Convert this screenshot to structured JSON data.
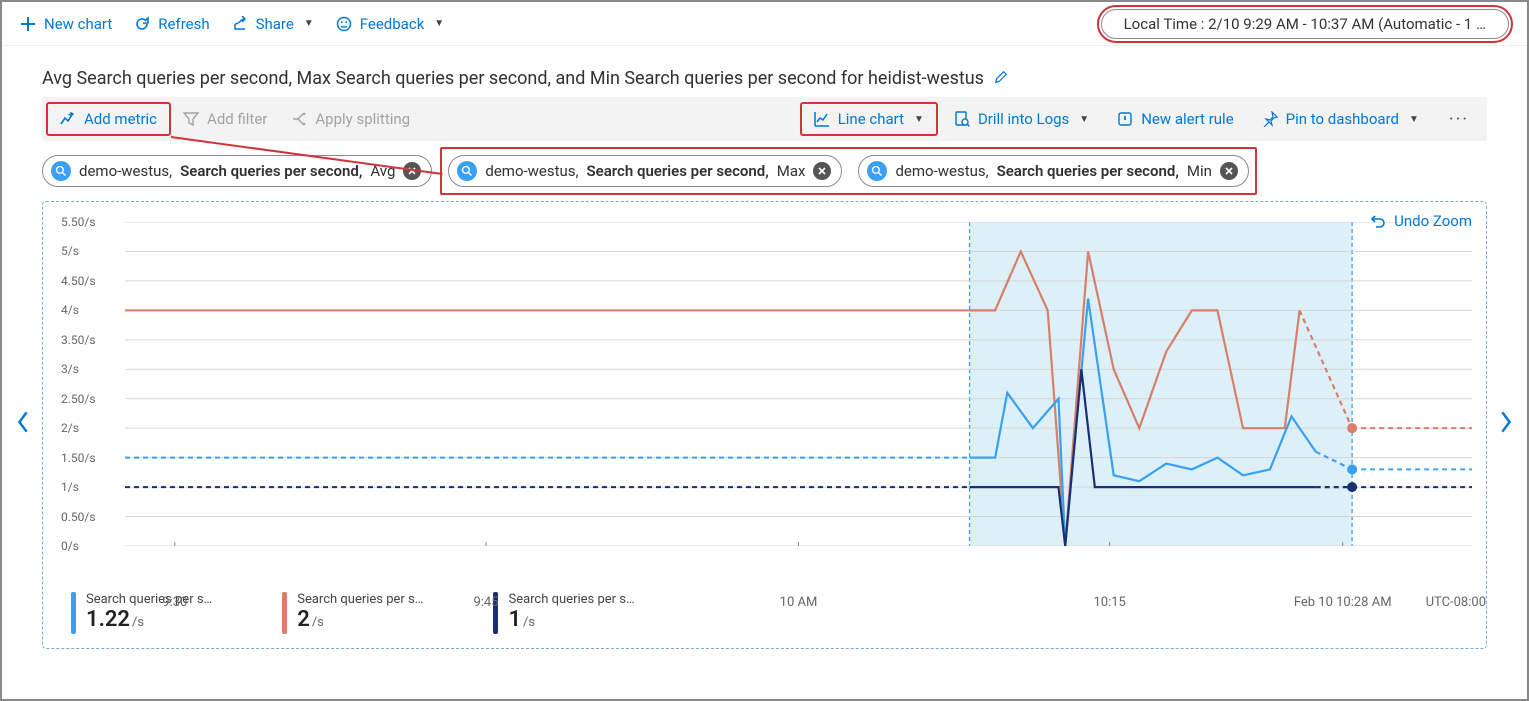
{
  "toolbar": {
    "new_chart": "New chart",
    "refresh": "Refresh",
    "share": "Share",
    "feedback": "Feedback"
  },
  "time_range": "Local Time : 2/10 9:29 AM - 10:37 AM (Automatic - 1 …",
  "title": "Avg Search queries per second, Max Search queries per second, and Min Search queries per second for heidist-westus",
  "secondary": {
    "add_metric": "Add metric",
    "add_filter": "Add filter",
    "apply_splitting": "Apply splitting",
    "chart_type": "Line chart",
    "drill_logs": "Drill into Logs",
    "new_alert": "New alert rule",
    "pin_dash": "Pin to dashboard"
  },
  "chips": [
    {
      "scope": "demo-westus,",
      "metric": "Search queries per second,",
      "agg": "Avg"
    },
    {
      "scope": "demo-westus,",
      "metric": "Search queries per second,",
      "agg": "Max"
    },
    {
      "scope": "demo-westus,",
      "metric": "Search queries per second,",
      "agg": "Min"
    }
  ],
  "undo_zoom": "Undo Zoom",
  "chart_data": {
    "type": "line",
    "yticks": [
      "0/s",
      "0.50/s",
      "1/s",
      "1.50/s",
      "2/s",
      "2.50/s",
      "3/s",
      "3.50/s",
      "4/s",
      "4.50/s",
      "5/s",
      "5.50/s"
    ],
    "xticks": [
      {
        "x": 0.037,
        "label": "9:30"
      },
      {
        "x": 0.268,
        "label": "9:45"
      },
      {
        "x": 0.5,
        "label": "10 AM"
      },
      {
        "x": 0.731,
        "label": "10:15"
      },
      {
        "x": 0.904,
        "label": "Feb 10 10:28 AM"
      }
    ],
    "timezone": "UTC-08:00",
    "ylim": [
      0,
      5.5
    ],
    "zoom_region": {
      "x0": 0.627,
      "x1": 0.911
    },
    "series": [
      {
        "name": "Max",
        "color": "#d97e6a",
        "flat_y": 4.0,
        "flat_until_x": 0.627,
        "points": [
          [
            0.627,
            4.0
          ],
          [
            0.646,
            4.0
          ],
          [
            0.665,
            5.0
          ],
          [
            0.685,
            4.0
          ],
          [
            0.698,
            0.0
          ],
          [
            0.715,
            5.0
          ],
          [
            0.734,
            3.0
          ],
          [
            0.753,
            2.0
          ],
          [
            0.773,
            3.3
          ],
          [
            0.792,
            4.0
          ],
          [
            0.811,
            4.0
          ],
          [
            0.83,
            2.0
          ],
          [
            0.85,
            2.0
          ],
          [
            0.861,
            2.0
          ],
          [
            0.872,
            4.0
          ]
        ],
        "dotted_tail": [
          [
            0.872,
            4.0
          ],
          [
            0.911,
            2.0
          ]
        ],
        "end_marker": [
          0.911,
          2.0
        ]
      },
      {
        "name": "Avg",
        "color": "#3aa0f3",
        "flat_y": 1.5,
        "flat_until_x": 0.627,
        "dotted_flat": true,
        "points": [
          [
            0.627,
            1.5
          ],
          [
            0.646,
            1.5
          ],
          [
            0.655,
            2.6
          ],
          [
            0.674,
            2.0
          ],
          [
            0.693,
            2.5
          ],
          [
            0.698,
            0.0
          ],
          [
            0.715,
            4.2
          ],
          [
            0.734,
            1.2
          ],
          [
            0.753,
            1.1
          ],
          [
            0.773,
            1.4
          ],
          [
            0.792,
            1.3
          ],
          [
            0.811,
            1.5
          ],
          [
            0.83,
            1.2
          ],
          [
            0.85,
            1.3
          ],
          [
            0.866,
            2.2
          ],
          [
            0.884,
            1.6
          ]
        ],
        "dotted_tail": [
          [
            0.884,
            1.6
          ],
          [
            0.911,
            1.3
          ]
        ],
        "end_marker": [
          0.911,
          1.3
        ]
      },
      {
        "name": "Min",
        "color": "#1b2f73",
        "flat_y": 1.0,
        "flat_until_x": 0.627,
        "dotted_flat": true,
        "points": [
          [
            0.627,
            1.0
          ],
          [
            0.693,
            1.0
          ],
          [
            0.698,
            0.0
          ],
          [
            0.71,
            3.0
          ],
          [
            0.72,
            1.0
          ],
          [
            0.884,
            1.0
          ]
        ],
        "dotted_tail": [
          [
            0.884,
            1.0
          ],
          [
            0.911,
            1.0
          ]
        ],
        "end_marker": [
          0.911,
          1.0
        ]
      }
    ]
  },
  "legend": [
    {
      "color": "#3aa0f3",
      "label": "Search queries per s…",
      "value": "1.22",
      "unit": "/s"
    },
    {
      "color": "#d97e6a",
      "label": "Search queries per s…",
      "value": "2",
      "unit": "/s"
    },
    {
      "color": "#1b2f73",
      "label": "Search queries per s…",
      "value": "1",
      "unit": "/s"
    }
  ]
}
